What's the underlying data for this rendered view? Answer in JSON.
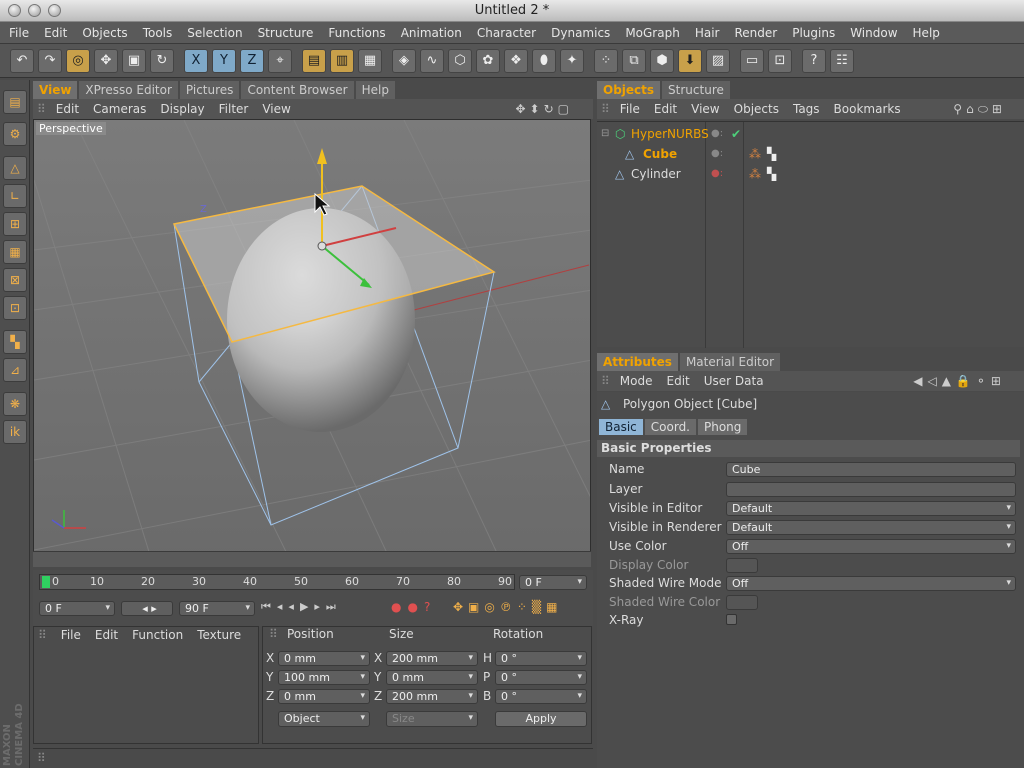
{
  "window": {
    "title": "Untitled 2 *"
  },
  "menu": [
    "File",
    "Edit",
    "Objects",
    "Tools",
    "Selection",
    "Structure",
    "Functions",
    "Animation",
    "Character",
    "Dynamics",
    "MoGraph",
    "Hair",
    "Render",
    "Plugins",
    "Window",
    "Help"
  ],
  "viewPanel": {
    "tabs": [
      "View",
      "XPresso Editor",
      "Pictures",
      "Content Browser",
      "Help"
    ],
    "submenu": [
      "Edit",
      "Cameras",
      "Display",
      "Filter",
      "View"
    ],
    "perspective": "Perspective"
  },
  "objectsPanel": {
    "tabs": [
      "Objects",
      "Structure"
    ],
    "submenu": [
      "File",
      "Edit",
      "View",
      "Objects",
      "Tags",
      "Bookmarks"
    ],
    "items": [
      {
        "name": "HyperNURBS"
      },
      {
        "name": "Cube"
      },
      {
        "name": "Cylinder"
      }
    ]
  },
  "attributes": {
    "tabs": [
      "Attributes",
      "Material Editor"
    ],
    "submenu": [
      "Mode",
      "Edit",
      "User Data"
    ],
    "objectTitle": "Polygon Object [Cube]",
    "subtabs": [
      "Basic",
      "Coord.",
      "Phong"
    ],
    "section": "Basic Properties",
    "props": [
      {
        "label": "Name",
        "value": "Cube"
      },
      {
        "label": "Layer",
        "value": ""
      },
      {
        "label": "Visible in Editor",
        "value": "Default"
      },
      {
        "label": "Visible in Renderer",
        "value": "Default"
      },
      {
        "label": "Use Color",
        "value": "Off"
      },
      {
        "label": "Display Color",
        "value": ""
      },
      {
        "label": "Shaded Wire Mode",
        "value": "Off"
      },
      {
        "label": "Shaded Wire Color",
        "value": ""
      },
      {
        "label": "X-Ray",
        "value": ""
      }
    ]
  },
  "timeline": {
    "ticks": [
      "0",
      "10",
      "20",
      "30",
      "40",
      "50",
      "60",
      "70",
      "80",
      "90"
    ],
    "currentFrame": "0 F",
    "startFrame": "0 F",
    "endFrame": "90 F"
  },
  "materials": {
    "menu": [
      "File",
      "Edit",
      "Function",
      "Texture"
    ]
  },
  "coords": {
    "headers": [
      "Position",
      "Size",
      "Rotation"
    ],
    "rows": [
      {
        "pl": "X",
        "pv": "0 mm",
        "sl": "X",
        "sv": "200 mm",
        "rl": "H",
        "rv": "0 °"
      },
      {
        "pl": "Y",
        "pv": "100 mm",
        "sl": "Y",
        "sv": "0 mm",
        "rl": "P",
        "rv": "0 °"
      },
      {
        "pl": "Z",
        "pv": "0 mm",
        "sl": "Z",
        "sv": "200 mm",
        "rl": "B",
        "rv": "0 °"
      }
    ],
    "mode": "Object",
    "sizeMode": "Size",
    "apply": "Apply"
  },
  "brand": {
    "line1": "MAXON",
    "line2": "CINEMA 4D"
  },
  "colors": {
    "accent": "#f0a200",
    "selection": "#f5b942",
    "uiBg": "#4a4a4a"
  }
}
